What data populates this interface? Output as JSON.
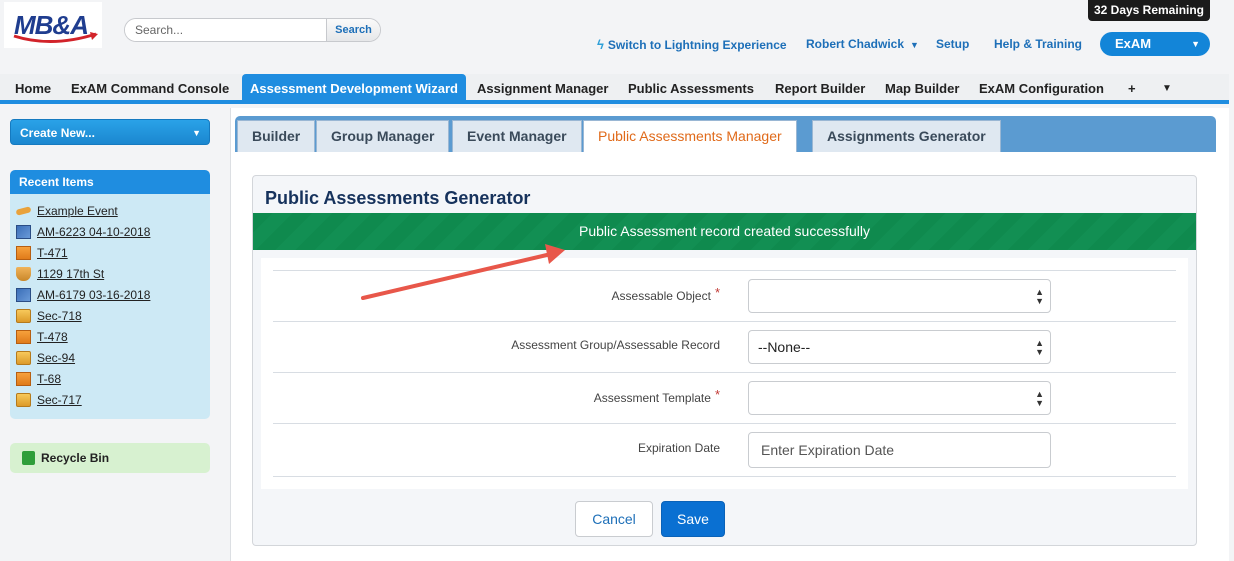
{
  "header": {
    "logo_text": "MB&A",
    "search": {
      "placeholder": "Search...",
      "button_label": "Search"
    },
    "trial_badge": "32 Days Remaining",
    "links": {
      "lightning": "Switch to Lightning Experience",
      "user": "Robert Chadwick",
      "setup": "Setup",
      "help": "Help & Training"
    },
    "app_switcher": "ExAM"
  },
  "nav": {
    "tabs": [
      {
        "label": "Home"
      },
      {
        "label": "ExAM Command Console"
      },
      {
        "label": "Assessment Development Wizard",
        "active": true
      },
      {
        "label": "Assignment Manager"
      },
      {
        "label": "Public Assessments"
      },
      {
        "label": "Report Builder"
      },
      {
        "label": "Map Builder"
      },
      {
        "label": "ExAM Configuration"
      },
      {
        "label": "+"
      },
      {
        "label": "▼"
      }
    ]
  },
  "sidebar": {
    "create_new": "Create New...",
    "recent_header": "Recent Items",
    "recent_items": [
      {
        "label": "Example Event",
        "icon": "event-icon"
      },
      {
        "label": "AM-6223 04-10-2018",
        "icon": "assignment-icon"
      },
      {
        "label": "T-471",
        "icon": "box-icon"
      },
      {
        "label": "1129 17th St",
        "icon": "shield-icon"
      },
      {
        "label": "AM-6179 03-16-2018",
        "icon": "assignment-icon"
      },
      {
        "label": "Sec-718",
        "icon": "stack-icon"
      },
      {
        "label": "T-478",
        "icon": "box-icon"
      },
      {
        "label": "Sec-94",
        "icon": "stack-icon"
      },
      {
        "label": "T-68",
        "icon": "box-icon"
      },
      {
        "label": "Sec-717",
        "icon": "stack-icon"
      }
    ],
    "recycle_bin": "Recycle Bin"
  },
  "subtabs": [
    {
      "label": "Builder"
    },
    {
      "label": "Group Manager"
    },
    {
      "label": "Event Manager"
    },
    {
      "label": "Public Assessments Manager",
      "active": true
    },
    {
      "label": "Assignments Generator"
    }
  ],
  "panel": {
    "title": "Public Assessments Generator",
    "success_message": "Public Assessment record created successfully",
    "fields": {
      "assessable_object": {
        "label": "Assessable Object",
        "value": ""
      },
      "assessment_group": {
        "label": "Assessment Group/Assessable Record",
        "value": "--None--"
      },
      "assessment_template": {
        "label": "Assessment Template",
        "value": ""
      },
      "expiration_date": {
        "label": "Expiration Date",
        "placeholder": "Enter Expiration Date"
      }
    },
    "required_marker": "*",
    "cancel_label": "Cancel",
    "save_label": "Save"
  },
  "colors": {
    "accent": "#1f8de0",
    "success": "#0f8a4e",
    "active_subtab_text": "#e06a1a",
    "save_button": "#0a70d2",
    "annotation_arrow": "#e8574a"
  }
}
